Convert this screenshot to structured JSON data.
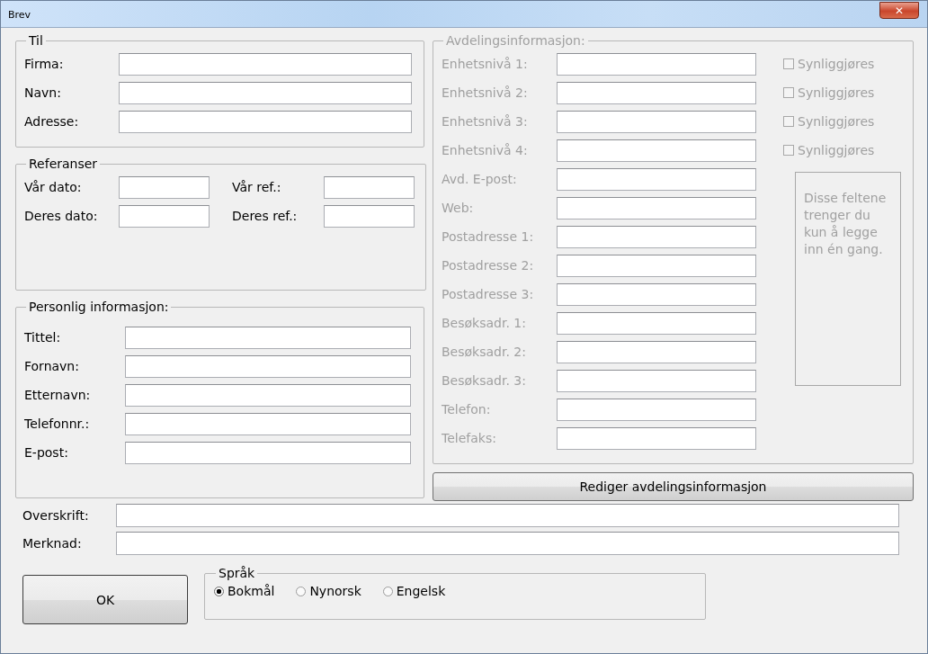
{
  "window": {
    "title": "Brev",
    "close_label": "✕"
  },
  "til": {
    "title": "Til",
    "fields": [
      {
        "label": "Firma:"
      },
      {
        "label": "Navn:"
      },
      {
        "label": "Adresse:"
      }
    ]
  },
  "referanser": {
    "title": "Referanser",
    "fields": [
      {
        "label": "Vår dato:"
      },
      {
        "label": "Vår ref.:"
      },
      {
        "label": "Deres dato:"
      },
      {
        "label": "Deres ref.:"
      }
    ]
  },
  "personlig": {
    "title": "Personlig informasjon:",
    "fields": [
      {
        "label": "Tittel:"
      },
      {
        "label": "Fornavn:"
      },
      {
        "label": "Etternavn:"
      },
      {
        "label": "Telefonnr.:"
      },
      {
        "label": "E-post:"
      }
    ]
  },
  "avdeling": {
    "title": "Avdelingsinformasjon:",
    "fields": [
      {
        "label": "Enhetsnivå 1:",
        "disabled": true,
        "checkbox": {
          "label": "Synliggjøres",
          "checked": false,
          "disabled": true
        }
      },
      {
        "label": "Enhetsnivå 2:",
        "disabled": true,
        "checkbox": {
          "label": "Synliggjøres",
          "checked": false,
          "disabled": true
        }
      },
      {
        "label": "Enhetsnivå 3:",
        "disabled": true,
        "checkbox": {
          "label": "Synliggjøres",
          "checked": false,
          "disabled": true
        }
      },
      {
        "label": "Enhetsnivå 4:",
        "disabled": true,
        "checkbox": {
          "label": "Synliggjøres",
          "checked": false,
          "disabled": true
        }
      },
      {
        "label": "Avd. E-post:",
        "disabled": true
      },
      {
        "label": "Web:",
        "disabled": true
      },
      {
        "label": "Postadresse 1:",
        "disabled": true
      },
      {
        "label": "Postadresse 2:",
        "disabled": true
      },
      {
        "label": "Postadresse 3:",
        "disabled": true
      },
      {
        "label": "Besøksadr. 1:",
        "disabled": true
      },
      {
        "label": "Besøksadr. 2:",
        "disabled": true
      },
      {
        "label": "Besøksadr. 3:",
        "disabled": true
      },
      {
        "label": "Telefon:",
        "disabled": true
      },
      {
        "label": "Telefaks:",
        "disabled": true
      }
    ],
    "note": "Disse feltene trenger du kun å legge inn én gang.",
    "edit_button": "Rediger avdelingsinformasjon"
  },
  "bottom_fields": [
    {
      "label": "Overskrift:"
    },
    {
      "label": "Merknad:"
    }
  ],
  "ok_button": "OK",
  "sprak": {
    "title": "Språk",
    "options": [
      {
        "label": "Bokmål",
        "selected": true
      },
      {
        "label": "Nynorsk",
        "selected": false
      },
      {
        "label": "Engelsk",
        "selected": false
      }
    ]
  }
}
